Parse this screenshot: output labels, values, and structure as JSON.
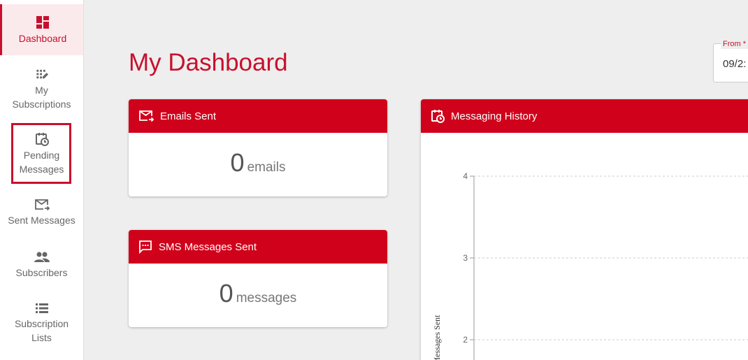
{
  "sidebar": {
    "items": [
      {
        "label": "Dashboard",
        "icon": "dashboard-icon"
      },
      {
        "label": "My\nSubscriptions",
        "icon": "subscriptions-icon"
      },
      {
        "label": "Pending\nMessages",
        "icon": "pending-messages-icon"
      },
      {
        "label": "Sent Messages",
        "icon": "sent-messages-icon"
      },
      {
        "label": "Subscribers",
        "icon": "subscribers-icon"
      },
      {
        "label": "Subscription\nLists",
        "icon": "list-icon"
      }
    ]
  },
  "page": {
    "title": "My Dashboard"
  },
  "date_from": {
    "label": "From *",
    "value": "09/2:"
  },
  "cards": {
    "emails": {
      "title": "Emails Sent",
      "count": "0",
      "unit": "emails"
    },
    "sms": {
      "title": "SMS Messages Sent",
      "count": "0",
      "unit": "messages"
    },
    "history": {
      "title": "Messaging History"
    }
  },
  "chart_data": {
    "type": "line",
    "ylabel": "Messages Sent",
    "yticks": [
      "4",
      "3",
      "2"
    ],
    "ytick_values": [
      4,
      3,
      2
    ],
    "grid": true
  },
  "colors": {
    "accent": "#c8102e",
    "header": "#d0021b"
  }
}
